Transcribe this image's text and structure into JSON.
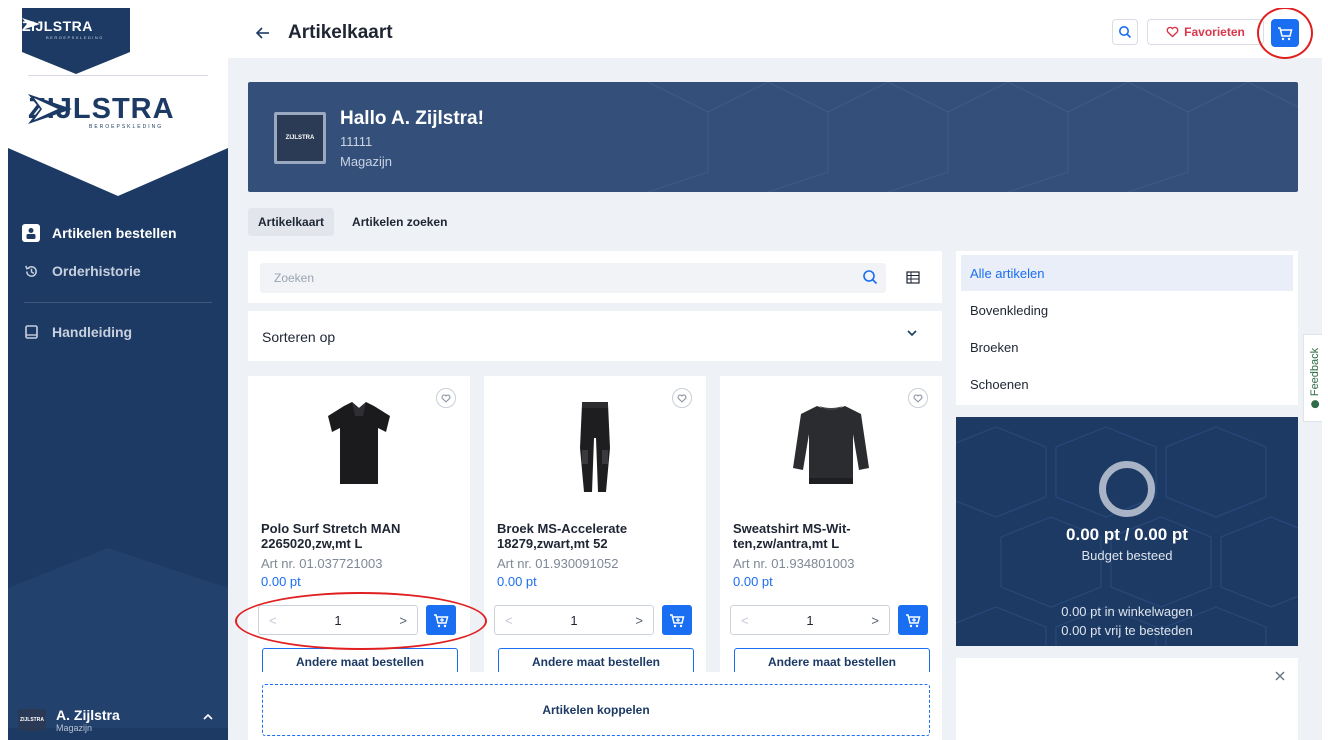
{
  "brand": {
    "name": "ZIJLSTRA",
    "tagline": "BEROEPSKLEDING"
  },
  "sidebar": {
    "nav": [
      {
        "label": "Artikelen bestellen",
        "icon": "person-uniform-icon",
        "active": true
      },
      {
        "label": "Orderhistorie",
        "icon": "history-icon",
        "active": false
      },
      {
        "label": "Handleiding",
        "icon": "book-icon",
        "active": false
      }
    ],
    "user": {
      "name": "A. Zijlstra",
      "role": "Magazijn",
      "avatar_text": "ZIJLSTRA"
    }
  },
  "topbar": {
    "title": "Artikelkaart",
    "favorites_label": "Favorieten"
  },
  "hero": {
    "greeting": "Hallo A. Zijlstra!",
    "number": "11111",
    "location": "Magazijn",
    "logo_text": "ZIJLSTRA"
  },
  "tabs": [
    {
      "label": "Artikelkaart",
      "active": true
    },
    {
      "label": "Artikelen zoeken",
      "active": false
    }
  ],
  "search": {
    "placeholder": "Zoeken"
  },
  "sort": {
    "label": "Sorteren op"
  },
  "products": [
    {
      "name": "Polo Surf Stretch MAN 2265020,zw,mt L",
      "art": "Art nr. 01.037721003",
      "price": "0.00 pt",
      "qty": "1",
      "other_size": "Andere maat bestellen",
      "image": "polo-shirt"
    },
    {
      "name": "Broek MS-Accelerate 18279,zwart,mt 52",
      "art": "Art nr. 01.930091052",
      "price": "0.00 pt",
      "qty": "1",
      "other_size": "Andere maat bestellen",
      "image": "trousers"
    },
    {
      "name": "Sweatshirt MS-Wit-ten,zw/antra,mt L",
      "art": "Art nr. 01.934801003",
      "price": "0.00 pt",
      "qty": "1",
      "other_size": "Andere maat bestellen",
      "image": "sweatshirt"
    }
  ],
  "link_articles": "Artikelen koppelen",
  "categories": [
    {
      "label": "Alle artikelen",
      "active": true
    },
    {
      "label": "Bovenkleding",
      "active": false
    },
    {
      "label": "Broeken",
      "active": false
    },
    {
      "label": "Schoenen",
      "active": false
    }
  ],
  "budget": {
    "value": "0.00 pt / 0.00 pt",
    "label": "Budget besteed",
    "in_cart": "0.00 pt in winkelwagen",
    "free": "0.00 pt vrij te besteden"
  },
  "feedback_label": "Feedback",
  "colors": {
    "navy": "#1c3a64",
    "accent_blue": "#1a6ef2",
    "favorite_red": "#d9374b",
    "annotation_red": "#e02020"
  }
}
